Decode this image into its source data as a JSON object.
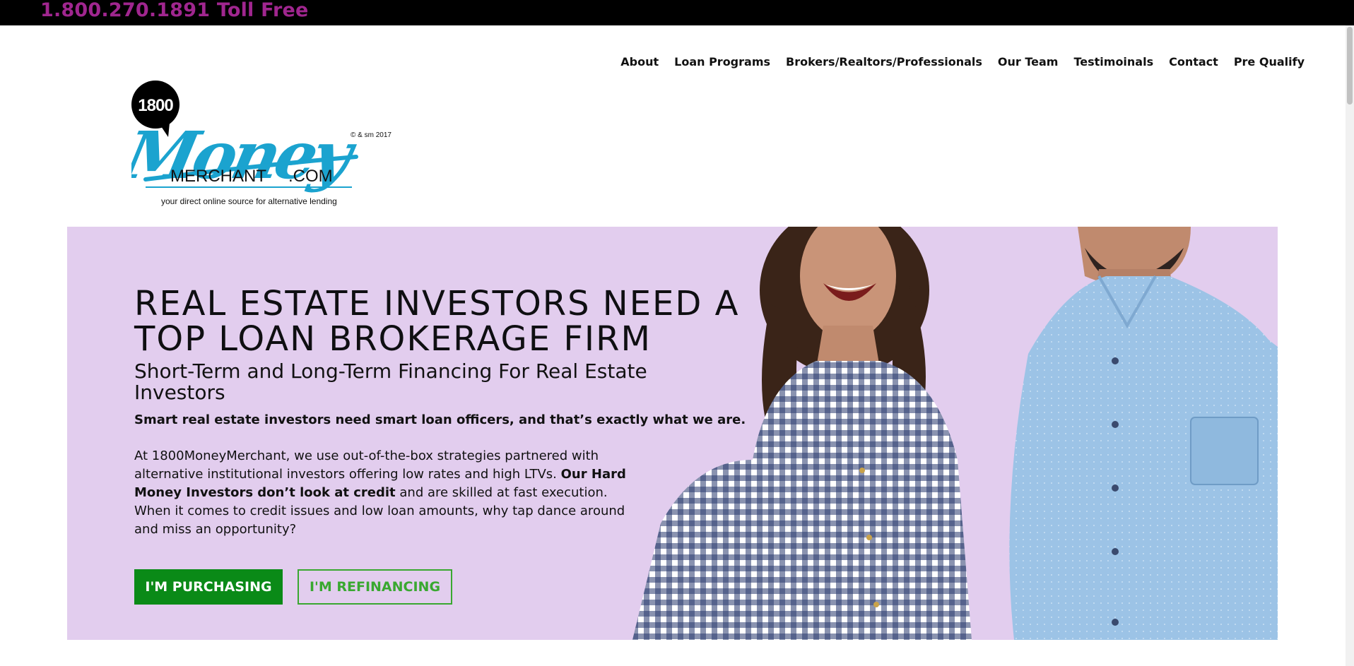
{
  "topbar": {
    "phone": "1.800.270.1891 Toll Free"
  },
  "nav": {
    "items": [
      "About",
      "Loan Programs",
      "Brokers/Realtors/Professionals",
      "Our Team",
      "Testimoinals",
      "Contact",
      "Pre Qualify"
    ]
  },
  "logo": {
    "badge": "1800",
    "script": "Money",
    "merchant": "MERCHANT",
    "com": ".COM",
    "copyright": "© & sm 2017",
    "tagline": "your direct online source for alternative lending"
  },
  "hero": {
    "headline": "REAL ESTATE INVESTORS NEED A TOP LOAN BROKERAGE FIRM",
    "subhead": "Short-Term and Long-Term Financing For Real Estate Investors",
    "lead": "Smart real estate investors need smart loan officers, and that’s exactly what we are.",
    "body_1": "At 1800MoneyMerchant, we use out-of-the-box strategies partnered with alternative institutional investors offering low rates and high LTVs. ",
    "body_bold": "Our Hard Money Investors don’t look at credit",
    "body_2": " and are skilled at fast execution. When it comes to credit issues and low loan amounts, why tap dance around and miss an opportunity?",
    "btn_purchase": "I'M PURCHASING",
    "btn_refinance": "I'M REFINANCING"
  },
  "colors": {
    "phone": "#a0268f",
    "hero_bg": "#e2cdee",
    "logo_blue": "#1ba3cf",
    "button_green": "#0a8a17",
    "outline_green": "#39a830"
  }
}
